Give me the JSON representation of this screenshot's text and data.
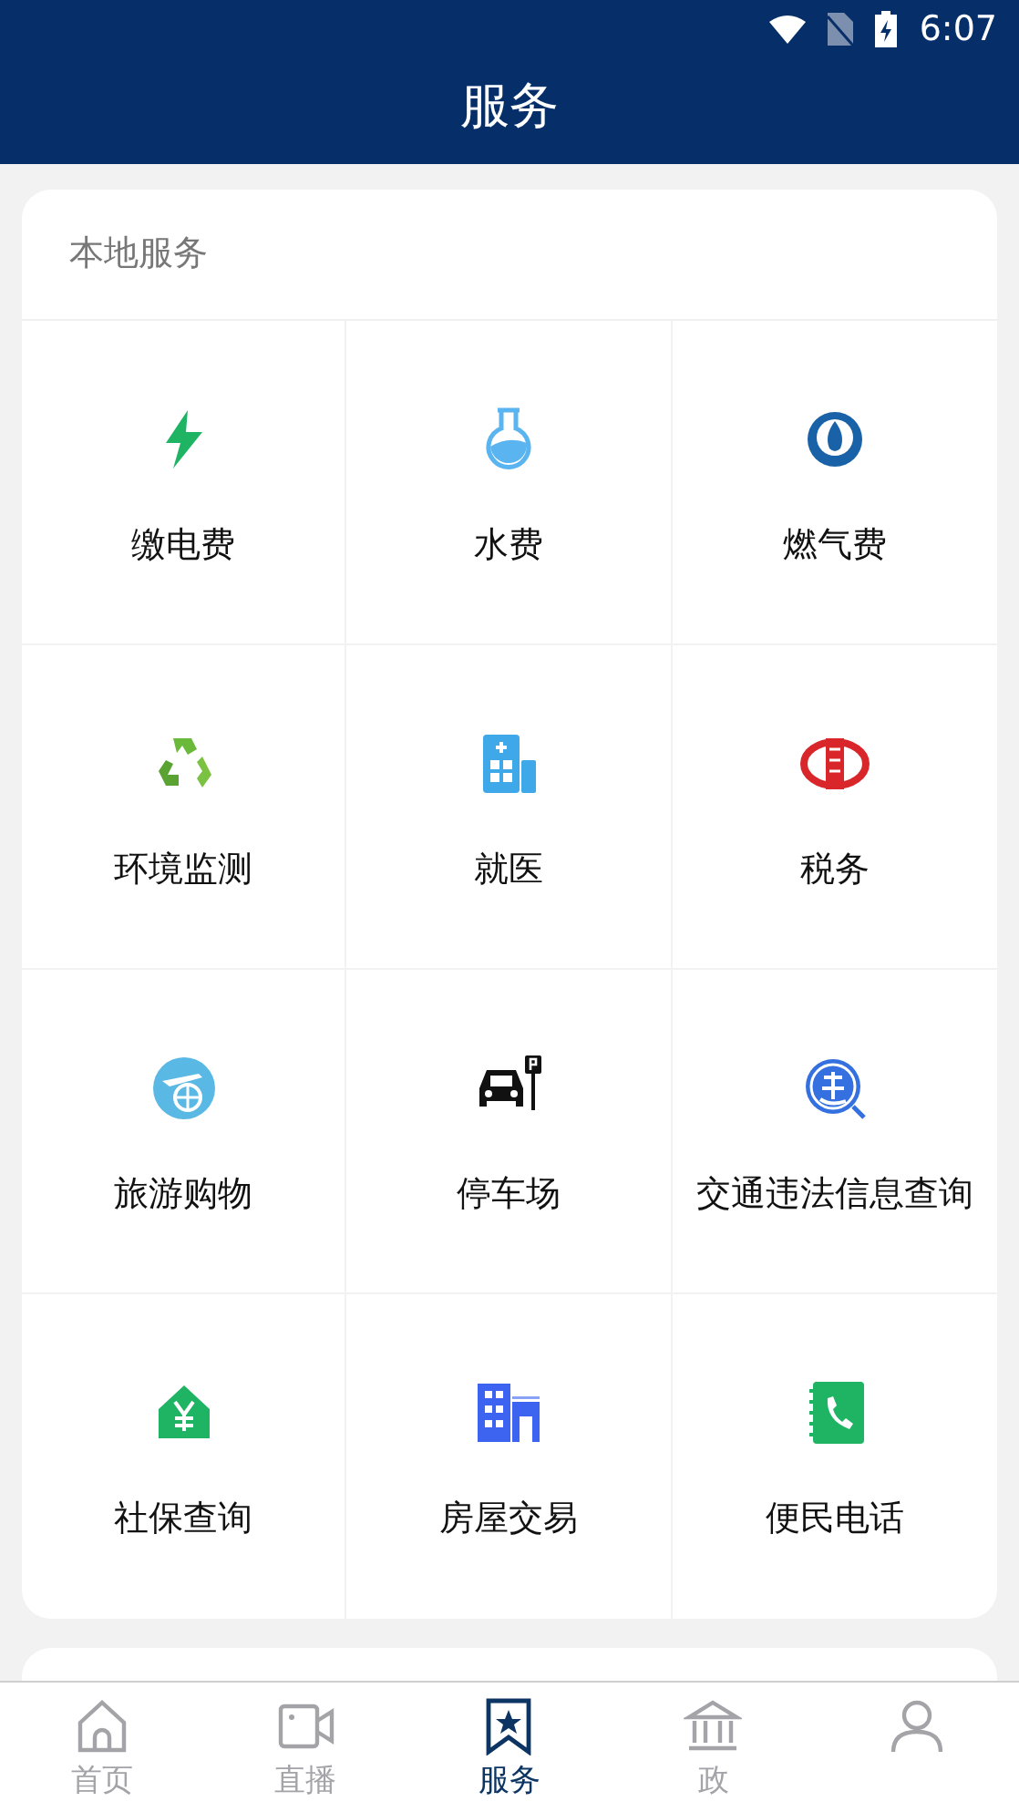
{
  "status_bar": {
    "time": "6:07"
  },
  "title": "服务",
  "section": {
    "title": "本地服务",
    "items": [
      {
        "label": "缴电费",
        "kind": "bolt"
      },
      {
        "label": "水费",
        "kind": "flask"
      },
      {
        "label": "燃气费",
        "kind": "flame"
      },
      {
        "label": "环境监测",
        "kind": "recycle"
      },
      {
        "label": "就医",
        "kind": "hospital"
      },
      {
        "label": "税务",
        "kind": "emblem"
      },
      {
        "label": "旅游购物",
        "kind": "plane"
      },
      {
        "label": "停车场",
        "kind": "car"
      },
      {
        "label": "交通违法信息查询",
        "kind": "violation"
      },
      {
        "label": "社保查询",
        "kind": "house"
      },
      {
        "label": "房屋交易",
        "kind": "buildings"
      },
      {
        "label": "便民电话",
        "kind": "phonebook"
      }
    ]
  },
  "nav": [
    {
      "label": "首页",
      "kind": "home",
      "selected": false
    },
    {
      "label": "直播",
      "kind": "video",
      "selected": false
    },
    {
      "label": "服务",
      "kind": "bookmark",
      "selected": true
    },
    {
      "label": "政",
      "kind": "bank",
      "selected": false
    },
    {
      "kind": "person",
      "selected": false
    }
  ]
}
